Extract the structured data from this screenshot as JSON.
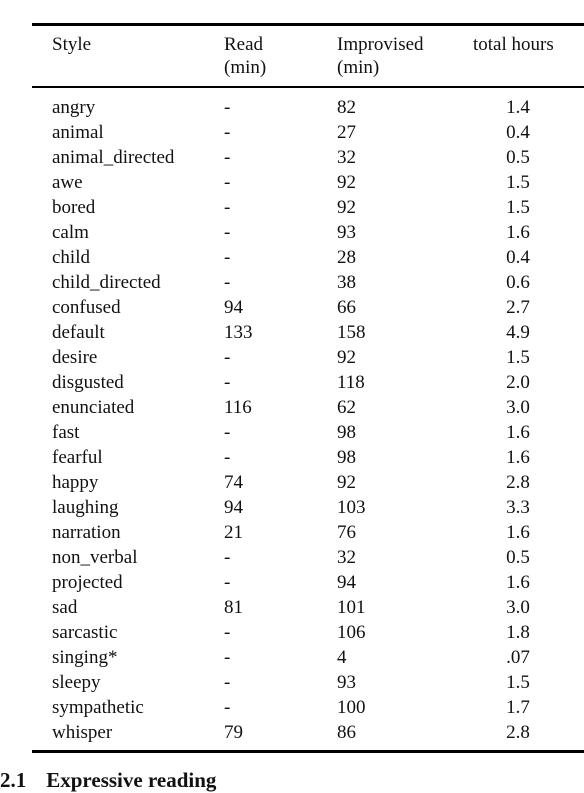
{
  "table": {
    "headers": [
      {
        "line1": "Style",
        "line2": ""
      },
      {
        "line1": "Read",
        "line2": "(min)"
      },
      {
        "line1": "Improvised",
        "line2": "(min)"
      },
      {
        "line1": "total hours",
        "line2": ""
      }
    ],
    "rows": [
      {
        "style": "angry",
        "read": "-",
        "improvised": "82",
        "total_hours": "1.4"
      },
      {
        "style": "animal",
        "read": "-",
        "improvised": "27",
        "total_hours": "0.4"
      },
      {
        "style": "animal_directed",
        "read": "-",
        "improvised": "32",
        "total_hours": "0.5"
      },
      {
        "style": "awe",
        "read": "-",
        "improvised": "92",
        "total_hours": "1.5"
      },
      {
        "style": "bored",
        "read": "-",
        "improvised": "92",
        "total_hours": "1.5"
      },
      {
        "style": "calm",
        "read": "-",
        "improvised": "93",
        "total_hours": "1.6"
      },
      {
        "style": "child",
        "read": "-",
        "improvised": "28",
        "total_hours": "0.4"
      },
      {
        "style": "child_directed",
        "read": "-",
        "improvised": "38",
        "total_hours": "0.6"
      },
      {
        "style": "confused",
        "read": "94",
        "improvised": "66",
        "total_hours": "2.7"
      },
      {
        "style": "default",
        "read": "133",
        "improvised": "158",
        "total_hours": "4.9"
      },
      {
        "style": "desire",
        "read": "-",
        "improvised": "92",
        "total_hours": "1.5"
      },
      {
        "style": "disgusted",
        "read": "-",
        "improvised": "118",
        "total_hours": "2.0"
      },
      {
        "style": "enunciated",
        "read": "116",
        "improvised": "62",
        "total_hours": "3.0"
      },
      {
        "style": "fast",
        "read": "-",
        "improvised": "98",
        "total_hours": "1.6"
      },
      {
        "style": "fearful",
        "read": "-",
        "improvised": "98",
        "total_hours": "1.6"
      },
      {
        "style": "happy",
        "read": "74",
        "improvised": "92",
        "total_hours": "2.8"
      },
      {
        "style": "laughing",
        "read": "94",
        "improvised": "103",
        "total_hours": "3.3"
      },
      {
        "style": "narration",
        "read": "21",
        "improvised": "76",
        "total_hours": "1.6"
      },
      {
        "style": "non_verbal",
        "read": "-",
        "improvised": "32",
        "total_hours": "0.5"
      },
      {
        "style": "projected",
        "read": "-",
        "improvised": "94",
        "total_hours": "1.6"
      },
      {
        "style": "sad",
        "read": "81",
        "improvised": "101",
        "total_hours": "3.0"
      },
      {
        "style": "sarcastic",
        "read": "-",
        "improvised": "106",
        "total_hours": "1.8"
      },
      {
        "style": "singing*",
        "read": "-",
        "improvised": "4",
        "total_hours": ".07"
      },
      {
        "style": "sleepy",
        "read": "-",
        "improvised": "93",
        "total_hours": "1.5"
      },
      {
        "style": "sympathetic",
        "read": "-",
        "improvised": "100",
        "total_hours": "1.7"
      },
      {
        "style": "whisper",
        "read": "79",
        "improvised": "86",
        "total_hours": "2.8"
      }
    ]
  },
  "section": {
    "number": "2.1",
    "title": "Expressive reading"
  }
}
